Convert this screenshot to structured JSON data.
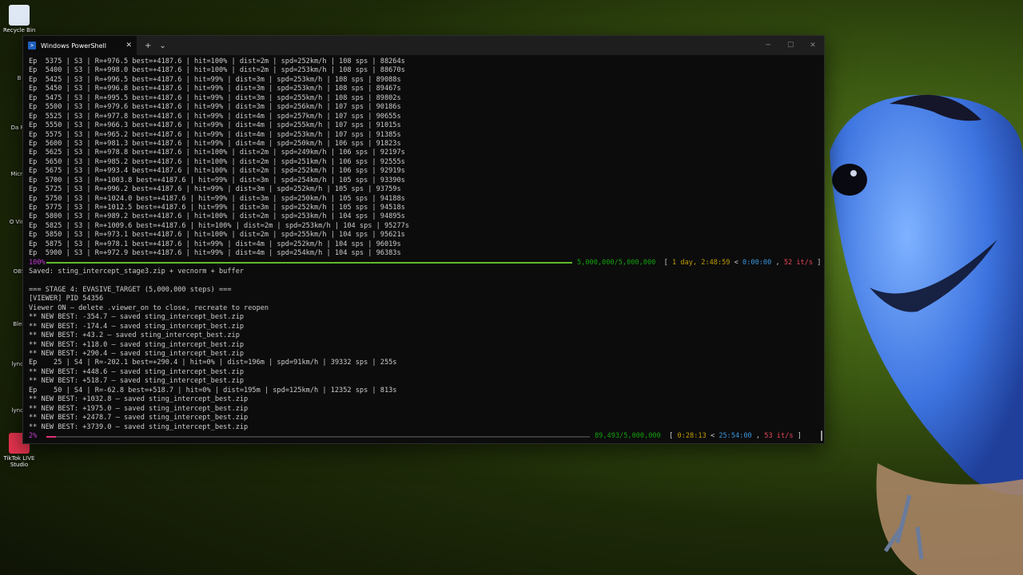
{
  "desktop": {
    "icons": [
      {
        "label": "Recycle Bin"
      },
      {
        "label": "B"
      },
      {
        "label": "Da Re"
      },
      {
        "label": "Micr E"
      },
      {
        "label": "O Virtu"
      },
      {
        "label": "OBS"
      },
      {
        "label": "Blen"
      },
      {
        "label": "lynch"
      },
      {
        "label": "lynch"
      },
      {
        "label": "TikTok LIVE Studio"
      }
    ]
  },
  "window": {
    "tab_title": "Windows PowerShell",
    "tab_close": "✕",
    "new_tab": "+",
    "dropdown": "⌄",
    "minimize": "─",
    "maximize": "☐",
    "close": "✕"
  },
  "console": {
    "lines": [
      "Ep  5375 | S3 | R=+976.5 best=+4187.6 | hit=100% | dist=2m | spd=252km/h | 108 sps | 88264s",
      "Ep  5400 | S3 | R=+998.0 best=+4187.6 | hit=100% | dist=2m | spd=253km/h | 108 sps | 88670s",
      "Ep  5425 | S3 | R=+996.5 best=+4187.6 | hit=99% | dist=3m | spd=253km/h | 108 sps | 89088s",
      "Ep  5450 | S3 | R=+996.8 best=+4187.6 | hit=99% | dist=3m | spd=253km/h | 108 sps | 89467s",
      "Ep  5475 | S3 | R=+995.5 best=+4187.6 | hit=99% | dist=3m | spd=255km/h | 108 sps | 89802s",
      "Ep  5500 | S3 | R=+979.6 best=+4187.6 | hit=99% | dist=3m | spd=256km/h | 107 sps | 90186s",
      "Ep  5525 | S3 | R=+977.8 best=+4187.6 | hit=99% | dist=4m | spd=257km/h | 107 sps | 90655s",
      "Ep  5550 | S3 | R=+966.3 best=+4187.6 | hit=99% | dist=4m | spd=255km/h | 107 sps | 91015s",
      "Ep  5575 | S3 | R=+965.2 best=+4187.6 | hit=99% | dist=4m | spd=253km/h | 107 sps | 91385s",
      "Ep  5600 | S3 | R=+981.3 best=+4187.6 | hit=99% | dist=4m | spd=250km/h | 106 sps | 91823s",
      "Ep  5625 | S3 | R=+978.8 best=+4187.6 | hit=100% | dist=2m | spd=249km/h | 106 sps | 92197s",
      "Ep  5650 | S3 | R=+985.2 best=+4187.6 | hit=100% | dist=2m | spd=251km/h | 106 sps | 92555s",
      "Ep  5675 | S3 | R=+993.4 best=+4187.6 | hit=100% | dist=2m | spd=252km/h | 106 sps | 92919s",
      "Ep  5700 | S3 | R=+1003.8 best=+4187.6 | hit=99% | dist=3m | spd=254km/h | 105 sps | 93390s",
      "Ep  5725 | S3 | R=+996.2 best=+4187.6 | hit=99% | dist=3m | spd=252km/h | 105 sps | 93759s",
      "Ep  5750 | S3 | R=+1024.0 best=+4187.6 | hit=99% | dist=3m | spd=250km/h | 105 sps | 94188s",
      "Ep  5775 | S3 | R=+1012.5 best=+4187.6 | hit=99% | dist=3m | spd=252km/h | 105 sps | 94518s",
      "Ep  5800 | S3 | R=+989.2 best=+4187.6 | hit=100% | dist=2m | spd=253km/h | 104 sps | 94895s",
      "Ep  5825 | S3 | R=+1009.6 best=+4187.6 | hit=100% | dist=2m | spd=253km/h | 104 sps | 95277s",
      "Ep  5850 | S3 | R=+973.1 best=+4187.6 | hit=100% | dist=2m | spd=255km/h | 104 sps | 95621s",
      "Ep  5875 | S3 | R=+978.1 best=+4187.6 | hit=99% | dist=4m | spd=252km/h | 104 sps | 96019s",
      "Ep  5900 | S3 | R=+972.9 best=+4187.6 | hit=99% | dist=4m | spd=254km/h | 104 sps | 96383s"
    ],
    "progress1": {
      "percent": "100%",
      "fraction": 1.0,
      "bar_color": "#5dbb2c",
      "count": "5,000,000/5,000,000",
      "open": "[",
      "elapsed": "1 day, 2:48:59",
      "lt": "<",
      "remaining": "0:00:00",
      "comma": ",",
      "rate": "52 it/s",
      "close": "]"
    },
    "lines2": [
      "Saved: sting_intercept_stage3.zip + vecnorm + buffer",
      "",
      "=== STAGE 4: EVASIVE_TARGET (5,000,000 steps) ===",
      "[VIEWER] PID 54356",
      "Viewer ON — delete .viewer_on to close, recreate to reopen",
      "** NEW BEST: -354.7 — saved sting_intercept_best.zip",
      "** NEW BEST: -174.4 — saved sting_intercept_best.zip",
      "** NEW BEST: +43.2 — saved sting_intercept_best.zip",
      "** NEW BEST: +118.0 — saved sting_intercept_best.zip",
      "** NEW BEST: +290.4 — saved sting_intercept_best.zip",
      "Ep    25 | S4 | R=-202.1 best=+290.4 | hit=0% | dist=196m | spd=91km/h | 39332 sps | 255s",
      "** NEW BEST: +448.6 — saved sting_intercept_best.zip",
      "** NEW BEST: +518.7 — saved sting_intercept_best.zip",
      "Ep    50 | S4 | R=-62.8 best=+518.7 | hit=0% | dist=195m | spd=125km/h | 12352 sps | 813s",
      "** NEW BEST: +1032.8 — saved sting_intercept_best.zip",
      "** NEW BEST: +1975.0 — saved sting_intercept_best.zip",
      "** NEW BEST: +2478.7 — saved sting_intercept_best.zip",
      "** NEW BEST: +3739.0 — saved sting_intercept_best.zip"
    ],
    "progress2": {
      "percent": "2%",
      "fraction": 0.018,
      "bar_color": "#e0307a",
      "count": "89,493/5,000,000",
      "open": "[",
      "elapsed": "0:28:13",
      "lt": "<",
      "remaining": "25:54:00",
      "comma": ",",
      "rate": "53 it/s",
      "close": "]"
    }
  }
}
